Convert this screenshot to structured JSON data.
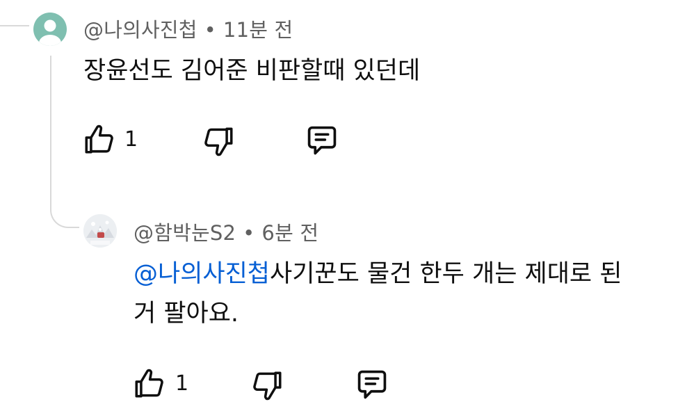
{
  "comment": {
    "author": "@나의사진첩",
    "separator": "•",
    "time": "11분 전",
    "text": "장윤선도 김어준 비판할때 있던데",
    "like_count": "1",
    "avatar_color": "#7fbfb0"
  },
  "reply": {
    "author": "@함박눈S2",
    "separator": "•",
    "time": "6분 전",
    "mention": "@나의사진첩",
    "text_line1": "사기꾼도 물건 한두 개는 제대로 된",
    "text_line2": "거 팔아요.",
    "like_count": "1"
  },
  "icons": [
    "thumbs-up-icon",
    "thumbs-down-icon",
    "reply-icon",
    "default-avatar-icon"
  ],
  "colors": {
    "mention": "#065fd4",
    "meta": "#606060",
    "thread_line": "#d9d9d9"
  }
}
